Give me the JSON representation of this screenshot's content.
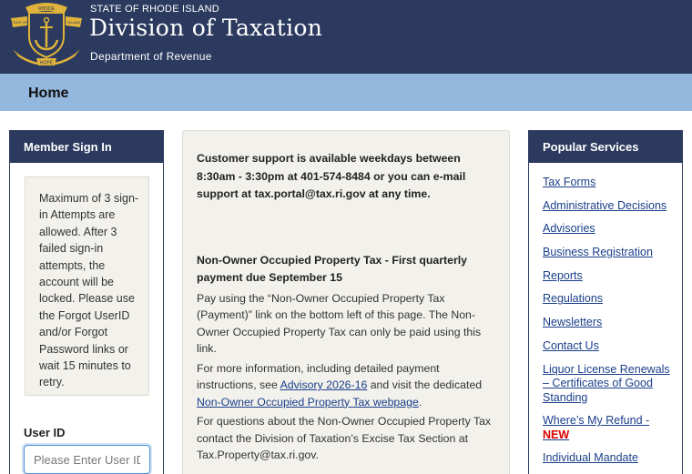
{
  "header": {
    "state_line": "STATE OF RHODE ISLAND",
    "title": "Division of Taxation",
    "subtitle": "Department of Revenue",
    "seal": {
      "top_text": "RHODE",
      "left_text": "STATE OF",
      "right_text": "ISLAND",
      "motto": "HOPE"
    },
    "colors": {
      "header_bg": "#2b3a5e",
      "nav_bg": "#93b7dd",
      "seal_gold": "#e0b43a"
    }
  },
  "nav": {
    "home_label": "Home"
  },
  "sign_in": {
    "heading": "Member Sign In",
    "notice": "Maximum of 3 sign-in Attempts are allowed. After 3 failed sign-in attempts, the account will be locked. Please use the Forgot UserID and/or Forgot Password links or wait 15 minutes to retry.",
    "userid_label": "User ID",
    "userid_placeholder": "Please Enter User ID",
    "userid_value": ""
  },
  "content": {
    "support_text": "Customer support is available weekdays between 8:30am - 3:30pm at 401-574-8484 or you can e-mail support at tax.portal@tax.ri.gov at any time.",
    "property_title": "Non-Owner Occupied Property Tax - First quarterly payment due September 15",
    "para1": "Pay using the “Non-Owner Occupied Property Tax (Payment)” link on the bottom left of this page. The Non-Owner Occupied Property Tax can only be paid using this link.",
    "para2_a": "For more information, including detailed payment instructions, see ",
    "advisory_link": "Advisory 2026-16",
    "para2_b": " and visit the dedicated ",
    "property_link": "Non-Owner Occupied Property Tax  webpage",
    "para2_c": ".",
    "para3": "For questions about the Non-Owner Occupied Property Tax contact the Division of Taxation’s Excise Tax Section at Tax.Property@tax.ri.gov."
  },
  "popular": {
    "heading": "Popular Services",
    "items": [
      "Tax Forms",
      "Administrative Decisions",
      "Advisories",
      "Business Registration",
      "Reports",
      "Regulations",
      "Newsletters",
      "Contact Us",
      "Liquor License Renewals – Certificates of Good Standing",
      "Where’s My Refund -",
      "Individual Mandate"
    ],
    "new_tag": "NEW"
  }
}
